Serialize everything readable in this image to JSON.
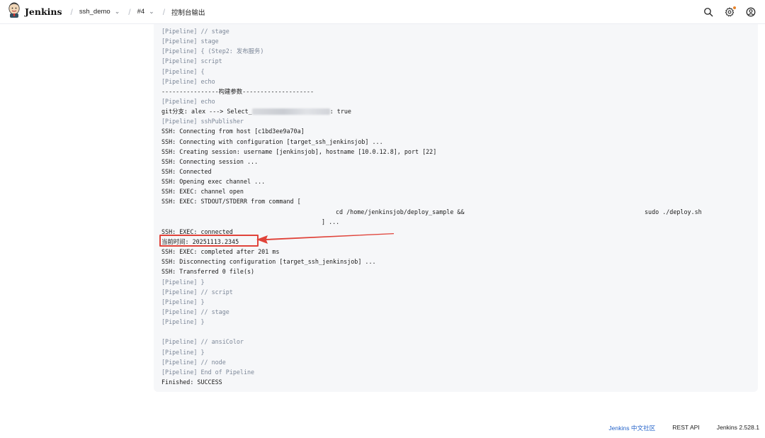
{
  "header": {
    "brand": "Jenkins",
    "breadcrumbs": [
      {
        "label": "ssh_demo",
        "has_menu": true
      },
      {
        "label": "#4",
        "has_menu": true
      },
      {
        "label": "控制台输出",
        "has_menu": false
      }
    ],
    "icons": [
      "search-icon",
      "settings-icon",
      "user-icon"
    ],
    "notify_color": "#e8832a"
  },
  "console": {
    "lines": [
      {
        "text": "[Pipeline] // stage",
        "kind": "pipe"
      },
      {
        "text": "[Pipeline] stage",
        "kind": "pipe"
      },
      {
        "text": "[Pipeline] { (Step2: 发布服务)",
        "kind": "pipe"
      },
      {
        "text": "[Pipeline] script",
        "kind": "pipe"
      },
      {
        "text": "[Pipeline] {",
        "kind": "pipe"
      },
      {
        "text": "[Pipeline] echo",
        "kind": "pipe"
      },
      {
        "text": "----------------构建参数--------------------",
        "kind": "out"
      },
      {
        "text": "[Pipeline] echo",
        "kind": "pipe"
      },
      {
        "text_before": "git分支: alex ---> Select_",
        "text_after": ": true",
        "kind": "out",
        "redacted": true
      },
      {
        "text": "[Pipeline] sshPublisher",
        "kind": "pipe"
      },
      {
        "text": "SSH: Connecting from host [c1bd3ee9a70a]",
        "kind": "out"
      },
      {
        "text": "SSH: Connecting with configuration [target_ssh_jenkinsjob] ...",
        "kind": "out"
      },
      {
        "text": "SSH: Creating session: username [jenkinsjob], hostname [10.0.12.8], port [22]",
        "kind": "out"
      },
      {
        "text": "SSH: Connecting session ...",
        "kind": "out"
      },
      {
        "text": "SSH: Connected",
        "kind": "out"
      },
      {
        "text": "SSH: Opening exec channel ...",
        "kind": "out"
      },
      {
        "text": "SSH: EXEC: channel open",
        "kind": "out"
      },
      {
        "text": "SSH: EXEC: STDOUT/STDERR from command [",
        "kind": "out"
      },
      {
        "text": "cd /home/jenkinsjob/deploy_sample &&",
        "tail": "sudo ./deploy.sh",
        "kind": "indent1"
      },
      {
        "text": "] ...",
        "kind": "indent2"
      },
      {
        "text": "SSH: EXEC: connected",
        "kind": "out"
      },
      {
        "text": "当前时间: 20251113.2345",
        "kind": "out"
      },
      {
        "text": "SSH: EXEC: completed after 201 ms",
        "kind": "out"
      },
      {
        "text": "SSH: Disconnecting configuration [target_ssh_jenkinsjob] ...",
        "kind": "out"
      },
      {
        "text": "SSH: Transferred 0 file(s)",
        "kind": "out"
      },
      {
        "text": "[Pipeline] }",
        "kind": "pipe"
      },
      {
        "text": "[Pipeline] // script",
        "kind": "pipe"
      },
      {
        "text": "[Pipeline] }",
        "kind": "pipe"
      },
      {
        "text": "[Pipeline] // stage",
        "kind": "pipe"
      },
      {
        "text": "[Pipeline] }",
        "kind": "pipe"
      },
      {
        "text": "",
        "kind": "out"
      },
      {
        "text": "[Pipeline] // ansiColor",
        "kind": "pipe"
      },
      {
        "text": "[Pipeline] }",
        "kind": "pipe"
      },
      {
        "text": "[Pipeline] // node",
        "kind": "pipe"
      },
      {
        "text": "[Pipeline] End of Pipeline",
        "kind": "pipe"
      },
      {
        "text": "Finished: SUCCESS",
        "kind": "out"
      }
    ]
  },
  "annotation": {
    "color": "#e0433a"
  },
  "footer": {
    "community_link": "Jenkins 中文社区",
    "api_link": "REST API",
    "version": "Jenkins 2.528.1"
  }
}
